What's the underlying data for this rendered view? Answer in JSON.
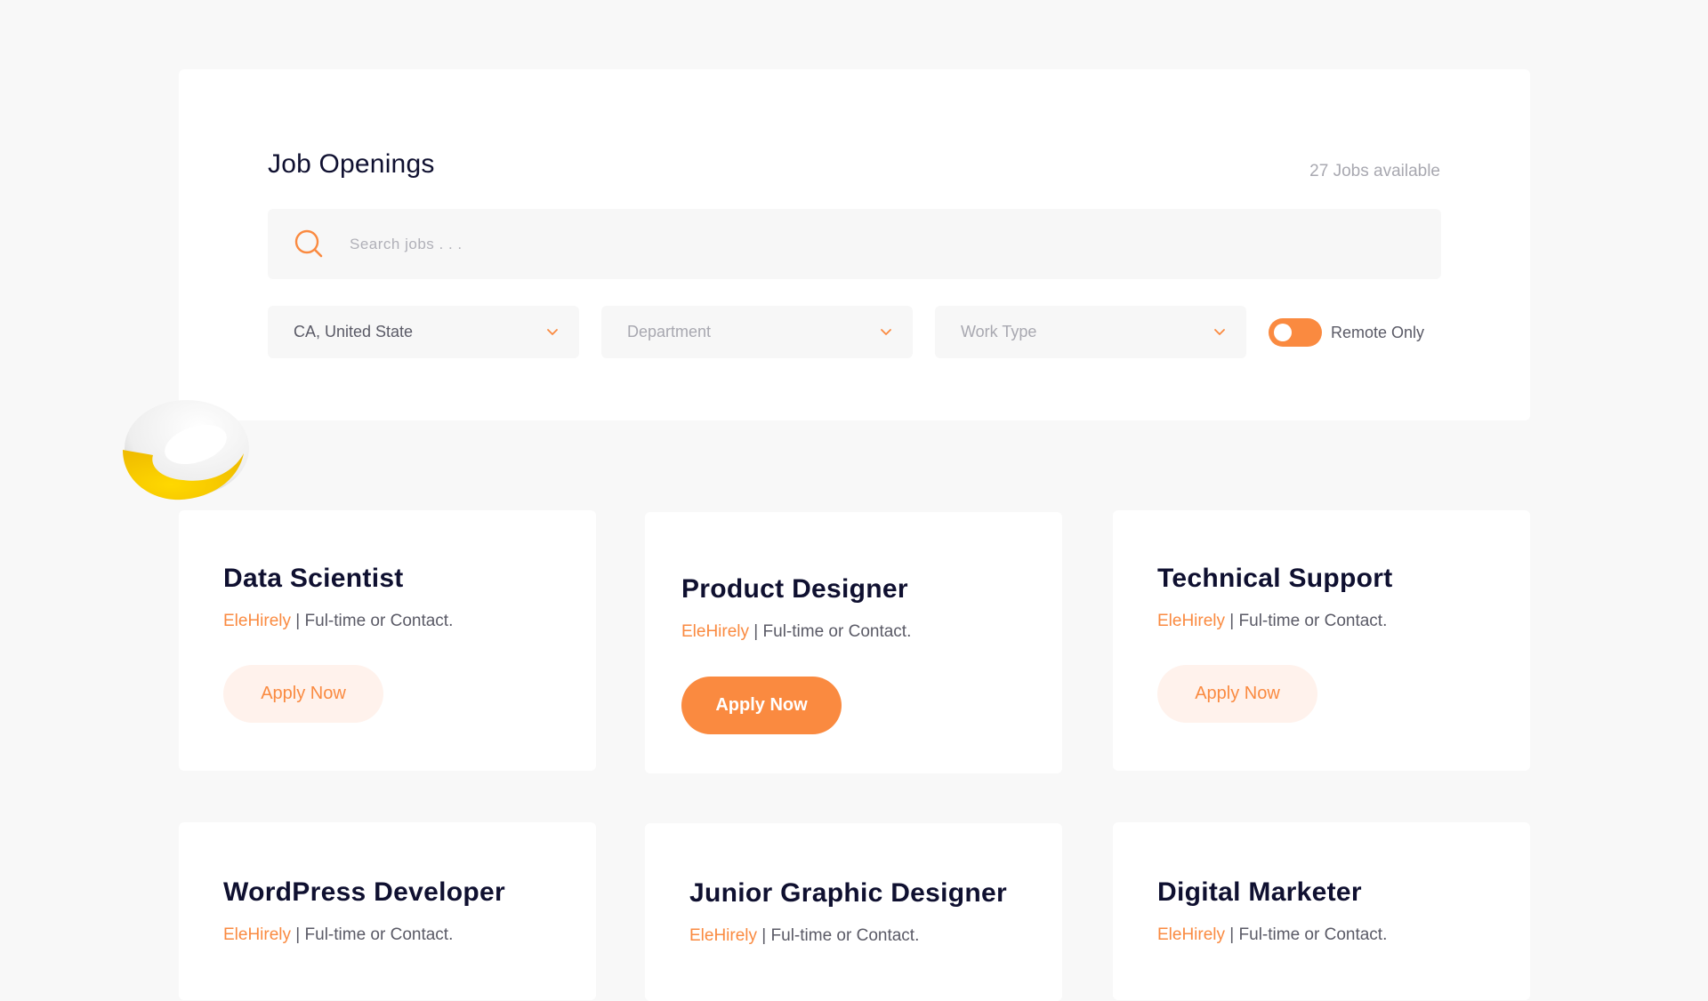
{
  "colors": {
    "accent": "#fa8a40",
    "accent_soft": "#fff2ec",
    "background": "#f8f8f8",
    "title": "#0f1030",
    "muted": "#a8a8b0",
    "deco_yellow": "#f5c800"
  },
  "filters": {
    "title": "Job Openings",
    "jobs_count": "27 Jobs available",
    "search": {
      "placeholder": "Search jobs . . .",
      "value": "",
      "icon": "search-icon"
    },
    "location": {
      "value": "CA, United State",
      "icon": "chevron-down-icon"
    },
    "department": {
      "placeholder": "Department",
      "icon": "chevron-down-icon"
    },
    "work_type": {
      "placeholder": "Work Type",
      "icon": "chevron-down-icon"
    },
    "remote_toggle": {
      "label": "Remote Only",
      "on": true
    }
  },
  "jobs": [
    {
      "title": "Data Scientist",
      "company": "EleHirely",
      "separator": " | ",
      "type": "Ful-time or Contact.",
      "apply_label": "Apply Now",
      "highlighted": false
    },
    {
      "title": "Product Designer",
      "company": "EleHirely",
      "separator": " | ",
      "type": "Ful-time or Contact.",
      "apply_label": "Apply Now",
      "highlighted": true
    },
    {
      "title": "Technical Support",
      "company": "EleHirely",
      "separator": " | ",
      "type": "Ful-time or Contact.",
      "apply_label": "Apply Now",
      "highlighted": false
    },
    {
      "title": "WordPress Developer",
      "company": "EleHirely",
      "separator": " | ",
      "type": "Ful-time or Contact."
    },
    {
      "title": "Junior Graphic Designer",
      "company": "EleHirely",
      "separator": " | ",
      "type": "Ful-time or Contact."
    },
    {
      "title": "Digital Marketer",
      "company": "EleHirely",
      "separator": " | ",
      "type": "Ful-time or Contact."
    }
  ]
}
